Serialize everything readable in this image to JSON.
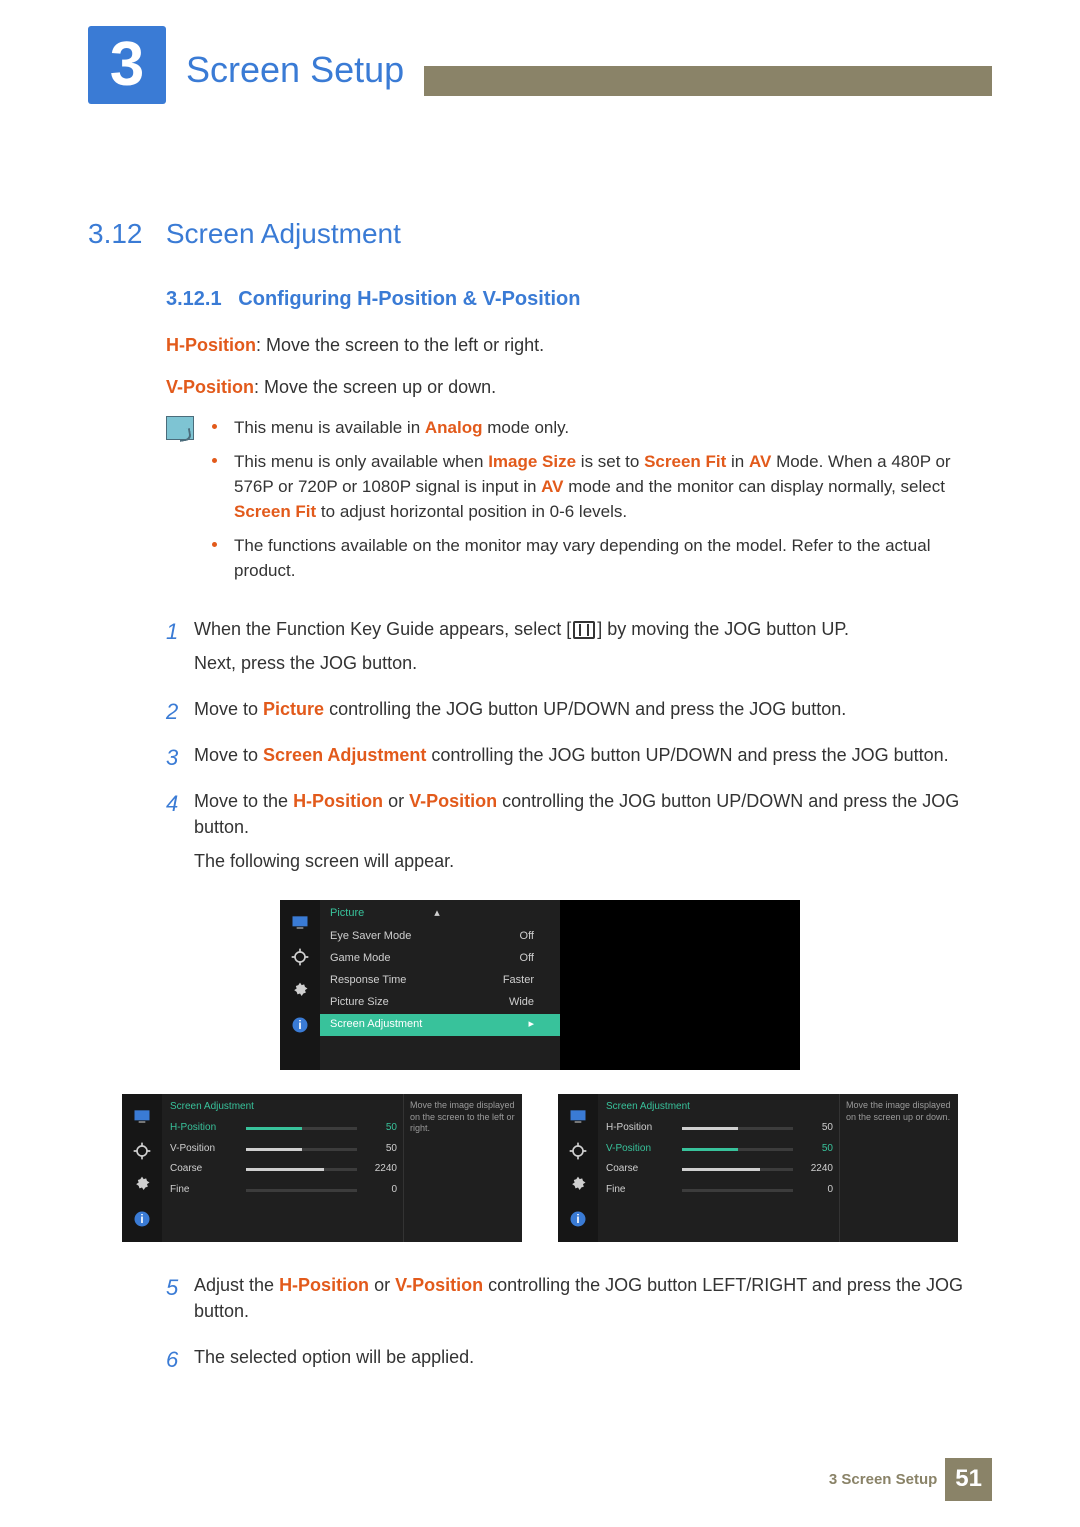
{
  "header": {
    "chapter_number": "3",
    "chapter_title": "Screen Setup"
  },
  "section": {
    "number": "3.12",
    "title": "Screen Adjustment"
  },
  "subsection": {
    "number": "3.12.1",
    "title": "Configuring H-Position & V-Position"
  },
  "intro": {
    "h_label": "H-Position",
    "h_text": ": Move the screen to the left or right.",
    "v_label": "V-Position",
    "v_text": ": Move the screen up or down."
  },
  "notes": {
    "n1_a": "This menu is available in ",
    "n1_b": "Analog",
    "n1_c": " mode only.",
    "n2_a": "This menu is only available when ",
    "n2_b": "Image Size",
    "n2_c": " is set to ",
    "n2_d": "Screen Fit",
    "n2_e": " in ",
    "n2_f": "AV",
    "n2_g": " Mode. When a 480P or 576P or 720P or 1080P signal is input in ",
    "n2_h": "AV",
    "n2_i": " mode and the monitor can display normally, select ",
    "n2_j": "Screen Fit",
    "n2_k": " to adjust horizontal position in 0-6 levels.",
    "n3": "The functions available on the monitor may vary depending on the model. Refer to the actual product."
  },
  "steps": {
    "s1": {
      "n": "1",
      "a": "When the Function Key Guide appears, select [",
      "b": "] by moving the JOG button UP.",
      "c": "Next, press the JOG button."
    },
    "s2": {
      "n": "2",
      "a": "Move to ",
      "b": "Picture",
      "c": " controlling the JOG button UP/DOWN and press the JOG button."
    },
    "s3": {
      "n": "3",
      "a": "Move to ",
      "b": "Screen Adjustment",
      "c": " controlling the JOG button UP/DOWN and press the JOG button."
    },
    "s4": {
      "n": "4",
      "a": "Move to the ",
      "b": "H-Position",
      "c": " or ",
      "d": "V-Position",
      "e": " controlling the JOG button UP/DOWN and press the JOG button.",
      "f": "The following screen will appear."
    },
    "s5": {
      "n": "5",
      "a": "Adjust the ",
      "b": "H-Position",
      "c": " or ",
      "d": "V-Position",
      "e": " controlling the JOG button LEFT/RIGHT and press the JOG button."
    },
    "s6": {
      "n": "6",
      "a": "The selected option will be applied."
    }
  },
  "osd1": {
    "title": "Picture",
    "rows": [
      {
        "label": "Eye Saver Mode",
        "value": "Off"
      },
      {
        "label": "Game Mode",
        "value": "Off"
      },
      {
        "label": "Response Time",
        "value": "Faster"
      },
      {
        "label": "Picture Size",
        "value": "Wide"
      }
    ],
    "selected": {
      "label": "Screen Adjustment",
      "arrow": "▸"
    }
  },
  "osd2_left": {
    "title": "Screen Adjustment",
    "help": "Move the image displayed on the screen to the left or right.",
    "rows": [
      {
        "label": "H-Position",
        "value": "50",
        "fill": 50,
        "selected": true
      },
      {
        "label": "V-Position",
        "value": "50",
        "fill": 50,
        "selected": false
      },
      {
        "label": "Coarse",
        "value": "2240",
        "fill": 70,
        "selected": false
      },
      {
        "label": "Fine",
        "value": "0",
        "fill": 0,
        "selected": false
      }
    ]
  },
  "osd2_right": {
    "title": "Screen Adjustment",
    "help": "Move the image displayed on the screen up or down.",
    "rows": [
      {
        "label": "H-Position",
        "value": "50",
        "fill": 50,
        "selected": false
      },
      {
        "label": "V-Position",
        "value": "50",
        "fill": 50,
        "selected": true
      },
      {
        "label": "Coarse",
        "value": "2240",
        "fill": 70,
        "selected": false
      },
      {
        "label": "Fine",
        "value": "0",
        "fill": 0,
        "selected": false
      }
    ]
  },
  "footer": {
    "label": "3 Screen Setup",
    "page": "51"
  }
}
